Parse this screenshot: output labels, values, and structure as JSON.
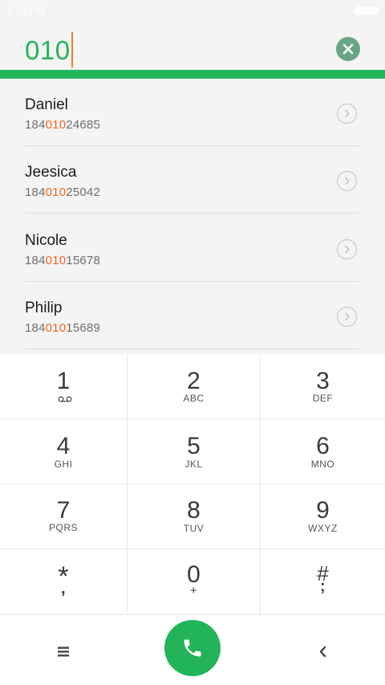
{
  "status_bar": {
    "time": "1:01PM"
  },
  "dialer": {
    "typed_number": "010"
  },
  "contacts": [
    {
      "name": "Daniel",
      "number_prefix": "184",
      "number_match": "010",
      "number_suffix": "24685"
    },
    {
      "name": "Jeesica",
      "number_prefix": "184",
      "number_match": "010",
      "number_suffix": "25042"
    },
    {
      "name": "Nicole",
      "number_prefix": "184",
      "number_match": "010",
      "number_suffix": "15678"
    },
    {
      "name": "Philip",
      "number_prefix": "184",
      "number_match": "010",
      "number_suffix": "15689"
    }
  ],
  "keypad": [
    {
      "digit": "1",
      "letters": ""
    },
    {
      "digit": "2",
      "letters": "ABC"
    },
    {
      "digit": "3",
      "letters": "DEF"
    },
    {
      "digit": "4",
      "letters": "GHI"
    },
    {
      "digit": "5",
      "letters": "JKL"
    },
    {
      "digit": "6",
      "letters": "MNO"
    },
    {
      "digit": "7",
      "letters": "PQRS"
    },
    {
      "digit": "8",
      "letters": "TUV"
    },
    {
      "digit": "9",
      "letters": "WXYZ"
    },
    {
      "digit": "*",
      "letters": ","
    },
    {
      "digit": "0",
      "letters": "+"
    },
    {
      "digit": "#",
      "letters": ";"
    }
  ],
  "icons": {
    "clear": "clear-icon",
    "voicemail": "voicemail-icon",
    "menu": "menu-icon",
    "call": "phone-icon",
    "back": "back-icon",
    "detail": "chevron-right-icon"
  },
  "colors": {
    "accent": "#23b45a",
    "highlight": "#f0661f",
    "cursor": "#f07d23",
    "clear_button": "#68a584"
  }
}
